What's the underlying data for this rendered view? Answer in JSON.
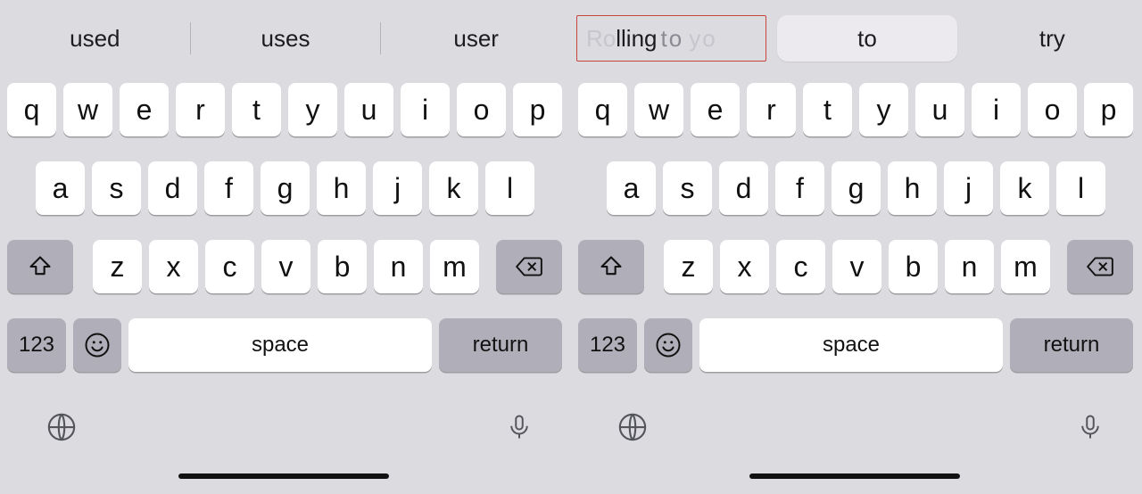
{
  "suggestions": {
    "left": [
      "used",
      "uses",
      "user"
    ],
    "right_boxed_main": "Rolling",
    "right_boxed_tail": "to",
    "right_boxed_tail2": "yo",
    "right_pill": "to",
    "right_last": "try"
  },
  "rows": {
    "r1": [
      "q",
      "w",
      "e",
      "r",
      "t",
      "y",
      "u",
      "i",
      "o",
      "p"
    ],
    "r2": [
      "a",
      "s",
      "d",
      "f",
      "g",
      "h",
      "j",
      "k",
      "l"
    ],
    "r3": [
      "z",
      "x",
      "c",
      "v",
      "b",
      "n",
      "m"
    ]
  },
  "labels": {
    "space": "space",
    "return": "return",
    "numbers": "123"
  },
  "icons": {
    "shift": "shift-icon",
    "backspace": "backspace-icon",
    "emoji": "emoji-icon",
    "globe": "globe-icon",
    "mic": "mic-icon"
  },
  "colors": {
    "key_white": "#ffffff",
    "key_gray": "#b0afb9",
    "bg": "#dcdbe0",
    "highlight_border": "#c7443e"
  }
}
